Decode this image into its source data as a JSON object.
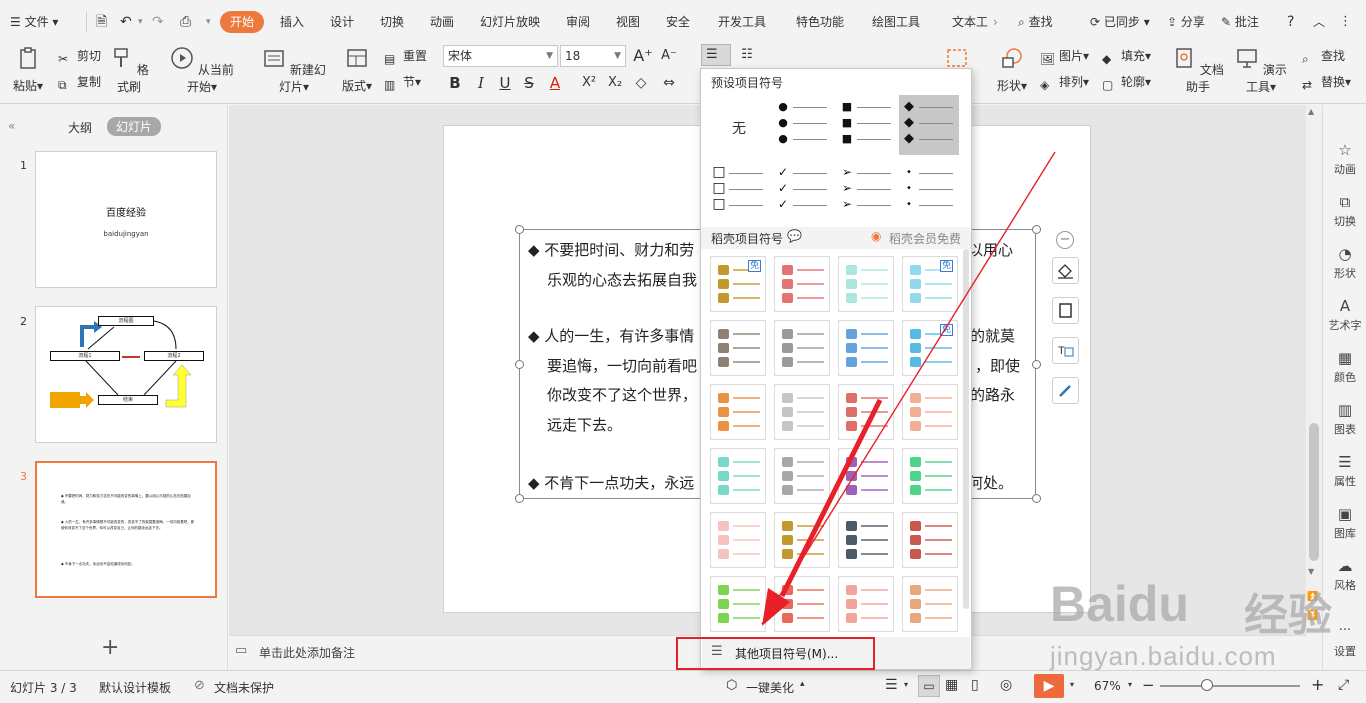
{
  "tabs": {
    "file": "文件",
    "items": [
      "开始",
      "插入",
      "设计",
      "切换",
      "动画",
      "幻灯片放映",
      "审阅",
      "视图",
      "安全",
      "开发工具",
      "特色功能",
      "绘图工具",
      "文本工"
    ],
    "search": "查找",
    "synced": "已同步",
    "share": "分享",
    "comment": "批注",
    "help": "?"
  },
  "ribbon": {
    "paste": "粘贴",
    "cut": "剪切",
    "copy": "复制",
    "format_painter": "格式刷",
    "from_current": "从当前开始",
    "new_slide": "新建幻灯片",
    "layout": "版式",
    "reset": "重置",
    "section": "节",
    "font_name": "宋体",
    "font_size": "18",
    "shape": "形状",
    "image": "图片",
    "fill": "填充",
    "arrange": "排列",
    "outline": "轮廓",
    "doc_helper": "文档助手",
    "present_tools": "演示工具",
    "find": "查找",
    "replace": "替换"
  },
  "leftpanel": {
    "outline_tab": "大纲",
    "slides_tab": "幻灯片",
    "slides": [
      {
        "num": "1",
        "title": "百度经验",
        "subtitle": "baidujingyan"
      },
      {
        "num": "2",
        "boxes": [
          "流程图",
          "流程1",
          "流程2",
          "结束"
        ]
      },
      {
        "num": "3",
        "lines": [
          "◆ 不要把时间、财力和劳力花在不可能改变的事情上，要以用心乐观的心态去拓展自我。",
          "◆ 人的一生，有许多事情是不可能改变的，改变不了的就莫要追悔，一切向前看吧，即使你改变不了这个世界，你可以改变自己，让你的路永远走下去。",
          "◆ 不肯下一点功夫，永远也不会知道成功何处。"
        ]
      }
    ],
    "add": "+"
  },
  "slide": {
    "p1a": "◆ 不要把时间、财力和劳",
    "p1b": "以用心",
    "p1c": "乐观的心态去拓展自我",
    "p2a": "◆ 人的一生，有许多事情",
    "p2b": "的就莫",
    "p2c": "要追悔，一切向前看吧",
    "p2d": "，即使",
    "p2e": "你改变不了这个世界，",
    "p2f": "的路永",
    "p2g": "远走下去。",
    "p3a": "◆ 不肯下一点功夫，永远",
    "p3b": "何处。"
  },
  "notes": "单击此处添加备注",
  "rightbar": [
    "动画",
    "切换",
    "形状",
    "艺术字",
    "颜色",
    "图表",
    "属性",
    "图库",
    "风格",
    "设置"
  ],
  "status": {
    "slide_count": "幻灯片 3 / 3",
    "template": "默认设计模板",
    "protect": "文档未保护",
    "beautify": "一键美化",
    "zoom": "67%"
  },
  "dropdown": {
    "preset_title": "预设项目符号",
    "none": "无",
    "daoke_title": "稻壳项目符号",
    "member_free": "稻壳会员免费",
    "free_badge": "免",
    "more": "其他项目符号(M)..."
  },
  "watermark": {
    "brand": "Baidu",
    "cn": "经验",
    "url": "jingyan.baidu.com"
  },
  "colors": {
    "accent": "#ed7a3c",
    "annotation_red": "#e8202a",
    "selected_gray": "#c7c7c7"
  }
}
